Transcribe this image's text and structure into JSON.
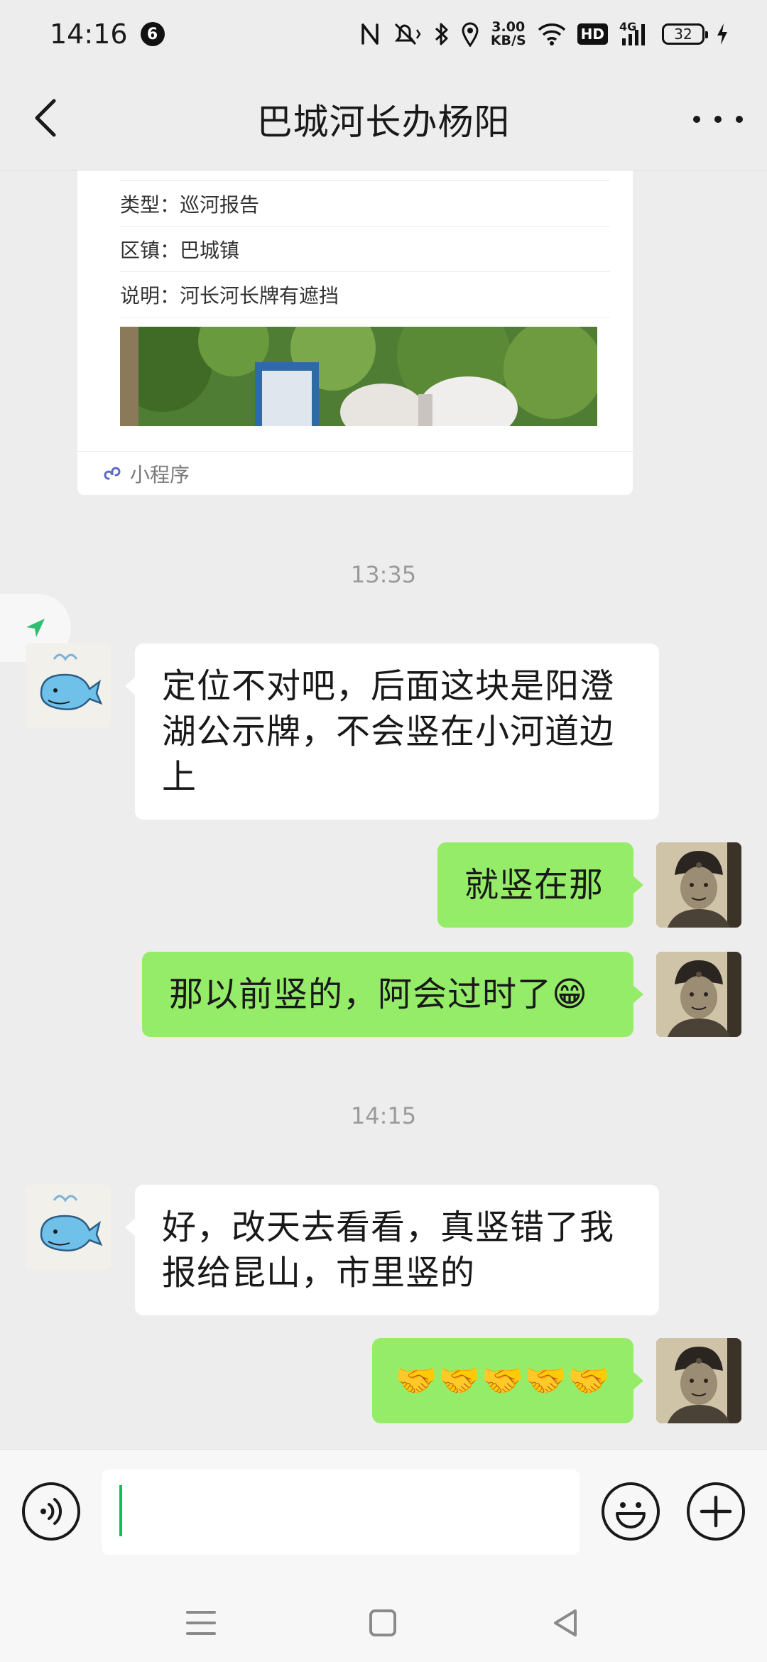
{
  "status_bar": {
    "time": "14:16",
    "notification_count": "6",
    "net_speed_value": "3.00",
    "net_speed_unit": "KB/S",
    "hd_label": "HD",
    "cell_label": "4G",
    "battery": "32"
  },
  "header": {
    "title": "巴城河长办杨阳"
  },
  "mini_program_card": {
    "rows": [
      {
        "text": "类型：巡河报告"
      },
      {
        "text": "区镇：巴城镇"
      },
      {
        "text": "说明：河长河长牌有遮挡"
      }
    ],
    "footer_label": "小程序"
  },
  "messages": [
    {
      "type": "time",
      "text": "13:35"
    },
    {
      "type": "incoming",
      "avatar": "whale-avatar",
      "text": "定位不对吧，后面这块是阳澄湖公示牌，不会竖在小河道边上"
    },
    {
      "type": "outgoing",
      "avatar": "soldier-avatar",
      "text": "就竖在那"
    },
    {
      "type": "outgoing",
      "avatar": "soldier-avatar",
      "text": "那以前竖的，阿会过时了😁"
    },
    {
      "type": "time",
      "text": "14:15"
    },
    {
      "type": "incoming",
      "avatar": "whale-avatar",
      "text": "好，改天去看看，真竖错了我报给昆山，市里竖的"
    },
    {
      "type": "outgoing",
      "avatar": "soldier-avatar",
      "text": "🤝🤝🤝🤝🤝"
    }
  ],
  "input_bar": {
    "value": ""
  },
  "icons": {
    "back": "chevron-left-icon",
    "more": "more-dots-icon",
    "voice": "voice-icon",
    "emoji": "emoji-icon",
    "plus": "plus-icon",
    "location": "location-arrow-icon",
    "mini_program": "mini-program-icon"
  },
  "colors": {
    "background": "#ededed",
    "outgoing_bubble": "#95ec69",
    "incoming_bubble": "#ffffff",
    "accent": "#07c160"
  }
}
